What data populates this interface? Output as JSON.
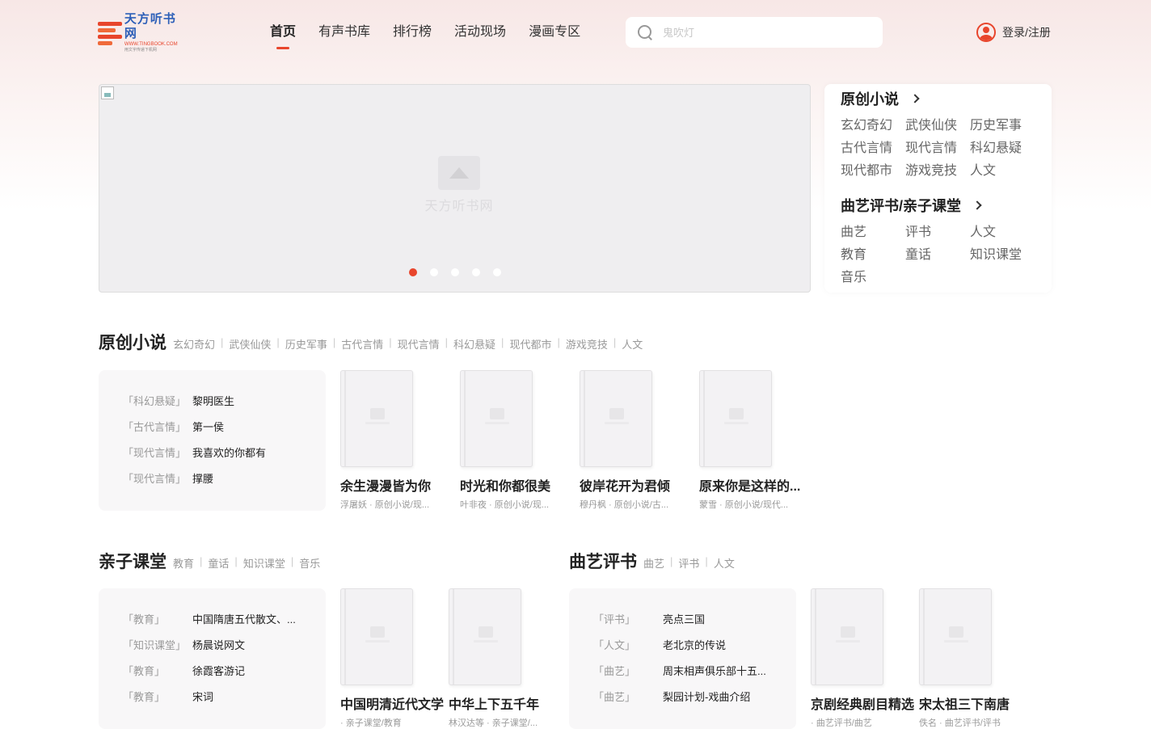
{
  "header": {
    "logo": {
      "name": "天方听书网",
      "url_text": "WWW.TINGBOOK.COM",
      "slogan": "用文字传递下机网"
    },
    "nav": [
      "首页",
      "有声书库",
      "排行榜",
      "活动现场",
      "漫画专区"
    ],
    "nav_active": "首页",
    "search_placeholder": "鬼吹灯",
    "login_label": "登录/注册"
  },
  "banner": {
    "watermark": "天方听书网",
    "slide_count": 5,
    "active_slide": 1,
    "accent_color": "#e8452c"
  },
  "category_panel": {
    "group1_title": "原创小说",
    "group1_items": [
      "玄幻奇幻",
      "武侠仙侠",
      "历史军事",
      "古代言情",
      "现代言情",
      "科幻悬疑",
      "现代都市",
      "游戏竞技",
      "人文"
    ],
    "group2_title": "曲艺评书/亲子课堂",
    "group2_items": [
      "曲艺",
      "评书",
      "人文",
      "教育",
      "童话",
      "知识课堂",
      "音乐"
    ]
  },
  "original": {
    "title": "原创小说",
    "tags": [
      "玄幻奇幻",
      "武侠仙侠",
      "历史军事",
      "古代言情",
      "现代言情",
      "科幻悬疑",
      "现代都市",
      "游戏竞技",
      "人文"
    ],
    "list": [
      {
        "cat": "「科幻悬疑」",
        "name": "黎明医生"
      },
      {
        "cat": "「古代言情」",
        "name": "第一侯"
      },
      {
        "cat": "「现代言情」",
        "name": "我喜欢的你都有"
      },
      {
        "cat": "「现代言情」",
        "name": "撑腰"
      }
    ],
    "books": [
      {
        "title": "余生漫漫皆为你",
        "meta": "浮屠妖 · 原创小说/现..."
      },
      {
        "title": "时光和你都很美",
        "meta": "叶非夜 · 原创小说/现..."
      },
      {
        "title": "彼岸花开为君倾",
        "meta": "穆丹枫 · 原创小说/古..."
      },
      {
        "title": "原来你是这样的...",
        "meta": "蒙雪 · 原创小说/现代..."
      }
    ]
  },
  "kids": {
    "title": "亲子课堂",
    "tags": [
      "教育",
      "童话",
      "知识课堂",
      "音乐"
    ],
    "list": [
      {
        "cat": "「教育」",
        "name": "中国隋唐五代散文、..."
      },
      {
        "cat": "「知识课堂」",
        "name": "杨晨说网文"
      },
      {
        "cat": "「教育」",
        "name": "徐霞客游记"
      },
      {
        "cat": "「教育」",
        "name": "宋词"
      }
    ],
    "books": [
      {
        "title": "中国明清近代文学",
        "meta": "· 亲子课堂/教育"
      },
      {
        "title": "中华上下五千年",
        "meta": "林汉达等 · 亲子课堂/..."
      }
    ]
  },
  "opera": {
    "title": "曲艺评书",
    "tags": [
      "曲艺",
      "评书",
      "人文"
    ],
    "list": [
      {
        "cat": "「评书」",
        "name": "亮点三国"
      },
      {
        "cat": "「人文」",
        "name": "老北京的传说"
      },
      {
        "cat": "「曲艺」",
        "name": "周末相声俱乐部十五..."
      },
      {
        "cat": "「曲艺」",
        "name": "梨园计划-戏曲介绍"
      }
    ],
    "books": [
      {
        "title": "京剧经典剧目精选",
        "meta": "· 曲艺评书/曲艺"
      },
      {
        "title": "宋太祖三下南唐",
        "meta": "佚名 · 曲艺评书/评书"
      }
    ]
  }
}
